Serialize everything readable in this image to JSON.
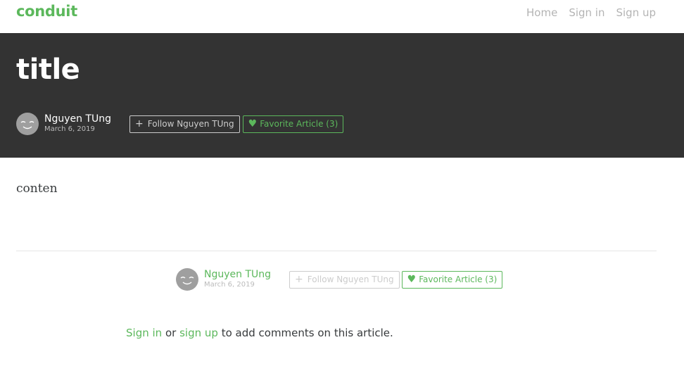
{
  "navbar": {
    "brand": "conduit",
    "links": [
      "Home",
      "Sign in",
      "Sign up"
    ]
  },
  "article": {
    "title": "title",
    "author": "Nguyen TUng",
    "date": "March 6, 2019",
    "follow_label": "Follow Nguyen TUng",
    "favorite_label": "Favorite Article (3)",
    "content": "conten"
  },
  "comments": {
    "sign_in": "Sign in",
    "or": "or",
    "sign_up": "sign up",
    "suffix": "to add comments on this article."
  },
  "colors": {
    "brand": "#5cb85c",
    "banner": "#333333",
    "muted": "#bbbbbb"
  }
}
